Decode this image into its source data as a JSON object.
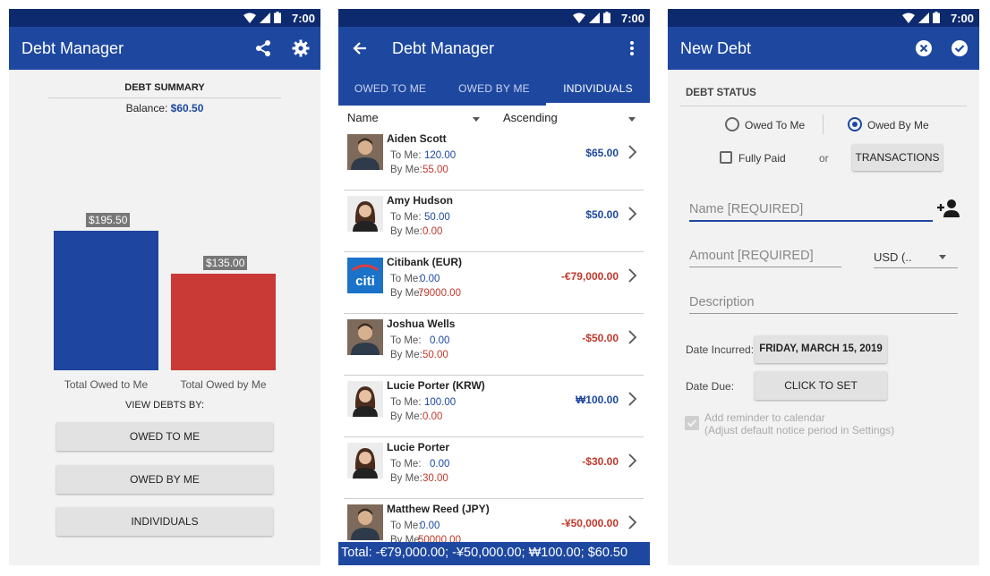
{
  "status": {
    "time": "7:00"
  },
  "summary": {
    "app_title": "Debt Manager",
    "section_title": "DEBT SUMMARY",
    "balance_label": "Balance:",
    "balance_value": "$60.50",
    "chart_data": {
      "type": "bar",
      "categories": [
        "Total Owed to Me",
        "Total Owed by Me"
      ],
      "values": [
        195.5,
        135.0
      ],
      "value_labels": [
        "$195.50",
        "$135.00"
      ],
      "colors": [
        "#1e45a0",
        "#c93a37"
      ],
      "ylim": [
        0,
        195.5
      ]
    },
    "view_by_label": "VIEW DEBTS BY:",
    "buttons": [
      "OWED TO ME",
      "OWED BY ME",
      "INDIVIDUALS"
    ]
  },
  "list": {
    "app_title": "Debt Manager",
    "tabs": [
      {
        "label": "OWED TO ME"
      },
      {
        "label": "OWED BY ME"
      },
      {
        "label": "INDIVIDUALS"
      }
    ],
    "sort_field": "Name",
    "sort_order": "Ascending",
    "to_me_label": "To Me:",
    "by_me_label": "By Me:",
    "rows": [
      {
        "name": "Aiden Scott",
        "to_me": "120.00",
        "by_me": "55.00",
        "amount": "$65.00",
        "amount_color": "#1e48a0",
        "avatar": "avatar-male"
      },
      {
        "name": "Amy Hudson",
        "to_me": "50.00",
        "by_me": "0.00",
        "amount": "$50.00",
        "amount_color": "#1e48a0",
        "avatar": "avatar-female"
      },
      {
        "name": "Citibank (EUR)",
        "to_me": "0.00",
        "by_me": "79000.00",
        "amount": "-€79,000.00",
        "amount_color": "#c0392b",
        "avatar": "citi-logo"
      },
      {
        "name": "Joshua Wells",
        "to_me": "0.00",
        "by_me": "50.00",
        "amount": "-$50.00",
        "amount_color": "#c0392b",
        "avatar": "avatar-male"
      },
      {
        "name": "Lucie Porter (KRW)",
        "to_me": "100.00",
        "by_me": "0.00",
        "amount": "₩100.00",
        "amount_color": "#1e48a0",
        "avatar": "avatar-female"
      },
      {
        "name": "Lucie Porter",
        "to_me": "0.00",
        "by_me": "30.00",
        "amount": "-$30.00",
        "amount_color": "#c0392b",
        "avatar": "avatar-female"
      },
      {
        "name": "Matthew Reed (JPY)",
        "to_me": "0.00",
        "by_me": "50000.00",
        "amount": "-¥50,000.00",
        "amount_color": "#c0392b",
        "avatar": "avatar-male"
      }
    ],
    "total": "Total: -€79,000.00; -¥50,000.00; ₩100.00; $60.50"
  },
  "form": {
    "title": "New Debt",
    "section": "DEBT STATUS",
    "radio_owed_to_me": "Owed To Me",
    "radio_owed_by_me": "Owed By Me",
    "fully_paid": "Fully Paid",
    "or": "or",
    "transactions": "TRANSACTIONS",
    "name_placeholder": "Name [REQUIRED]",
    "amount_placeholder": "Amount [REQUIRED]",
    "currency": "USD (..",
    "description_placeholder": "Description",
    "date_incurred_label": "Date Incurred:",
    "date_incurred_value": "FRIDAY, MARCH 15, 2019",
    "date_due_label": "Date Due:",
    "date_due_value": "CLICK TO SET",
    "reminder_line1": "Add reminder to calendar",
    "reminder_line2": "(Adjust default notice period in Settings)"
  }
}
